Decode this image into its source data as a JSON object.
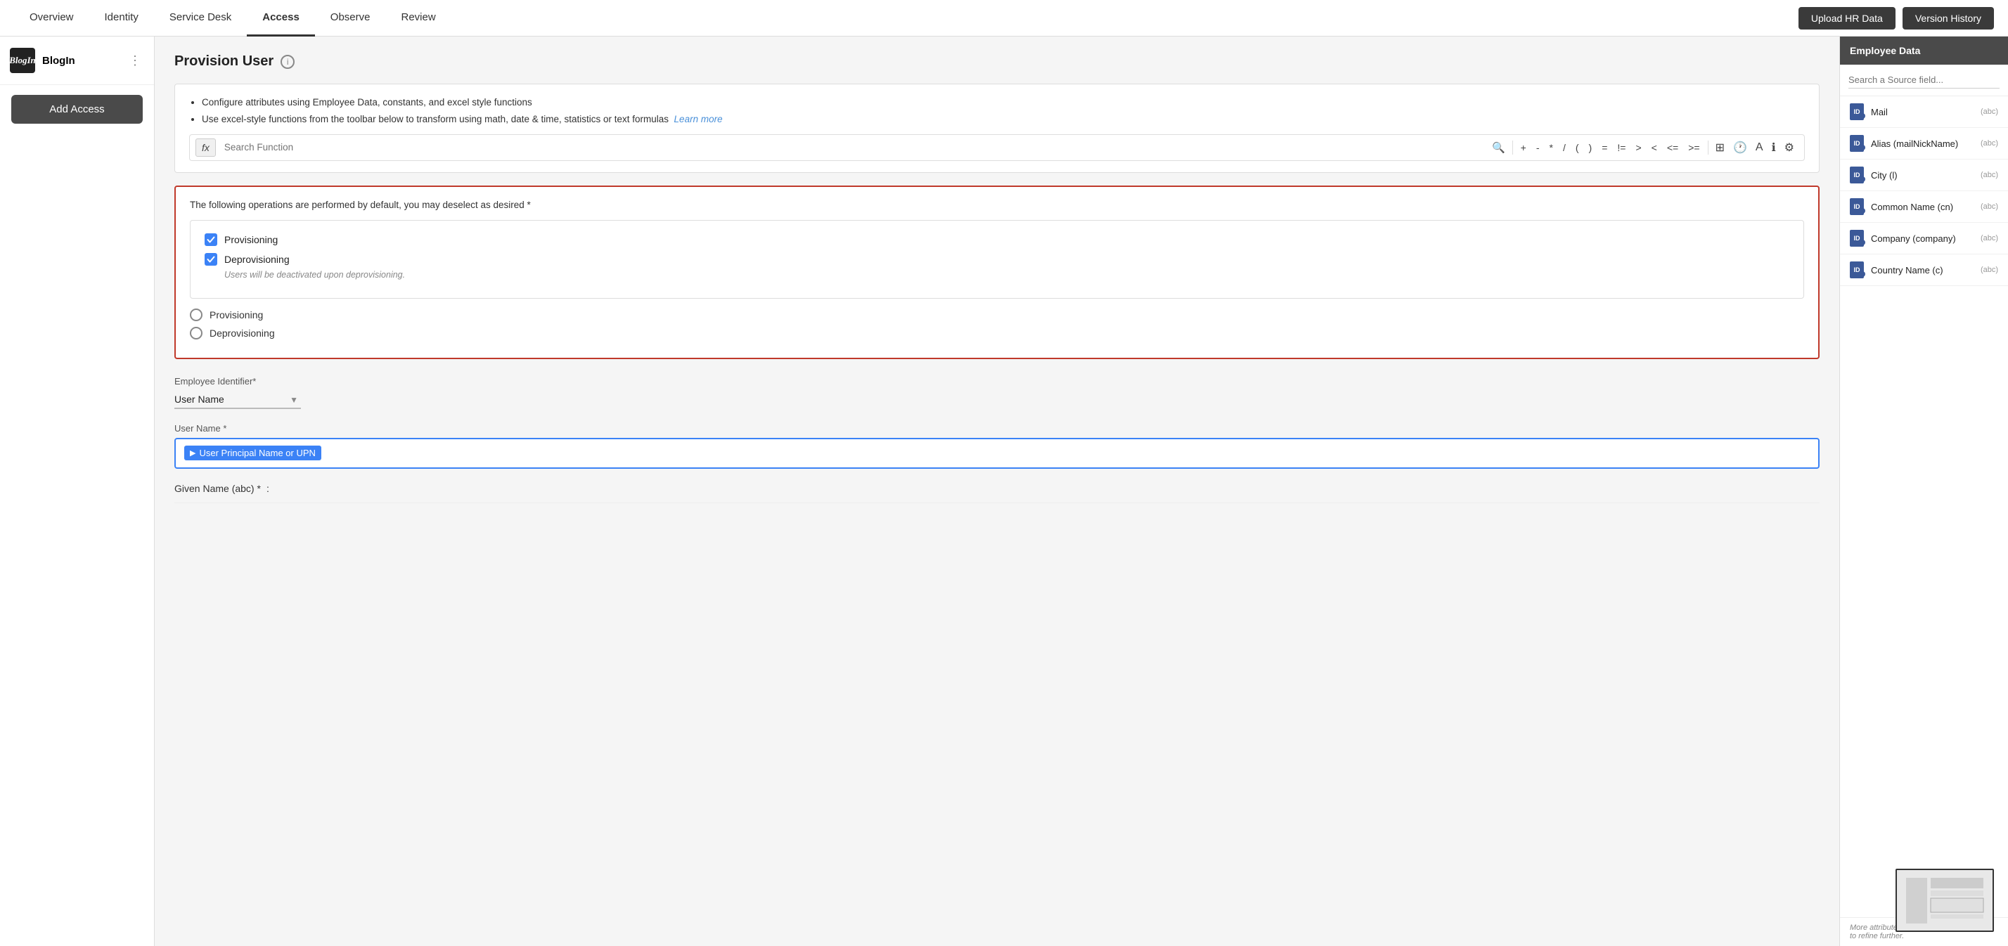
{
  "nav": {
    "links": [
      {
        "id": "overview",
        "label": "Overview",
        "active": false
      },
      {
        "id": "identity",
        "label": "Identity",
        "active": false
      },
      {
        "id": "service-desk",
        "label": "Service Desk",
        "active": false
      },
      {
        "id": "access",
        "label": "Access",
        "active": true
      },
      {
        "id": "observe",
        "label": "Observe",
        "active": false
      },
      {
        "id": "review",
        "label": "Review",
        "active": false
      }
    ],
    "upload_hr_label": "Upload HR Data",
    "version_history_label": "Version History"
  },
  "sidebar": {
    "logo_text": "BlogIn",
    "add_access_label": "Add Access"
  },
  "page": {
    "title": "Provision User",
    "info_lines": [
      "Configure attributes using Employee Data, constants, and excel style functions",
      "Use excel-style functions from the toolbar below to transform using math, date & time, statistics or text formulas"
    ],
    "learn_more_label": "Learn more",
    "search_function_placeholder": "Search Function",
    "toolbar_buttons": [
      "+",
      "-",
      "*",
      "/",
      "(",
      ")",
      "=",
      "!=",
      ">",
      "<",
      "<=",
      ">="
    ],
    "operations_desc": "The following operations are performed by default, you may deselect as desired *",
    "provisioning_label": "Provisioning",
    "deprovisioning_label": "Deprovisioning",
    "deprovisioning_note": "Users will be deactivated upon deprovisioning.",
    "radio_provisioning": "Provisioning",
    "radio_deprovisioning": "Deprovisioning",
    "employee_identifier_label": "Employee Identifier*",
    "user_name_select": "User Name",
    "user_name_label": "User Name *",
    "token_chip_label": "User Principal Name or UPN",
    "given_name_label": "Given Name (abc) *"
  },
  "right_panel": {
    "title": "Employee Data",
    "search_placeholder": "Search a Source field...",
    "fields": [
      {
        "name": "Mail",
        "type": "(abc)"
      },
      {
        "name": "Alias (mailNickName)",
        "type": "(abc)"
      },
      {
        "name": "City (l)",
        "type": "(abc)"
      },
      {
        "name": "Common Name (cn)",
        "type": "(abc)"
      },
      {
        "name": "Company (company)",
        "type": "(abc)"
      },
      {
        "name": "Country Name (c)",
        "type": "(abc)"
      }
    ],
    "more_attrs_note": "More attributes available, continue typing to refine further."
  }
}
